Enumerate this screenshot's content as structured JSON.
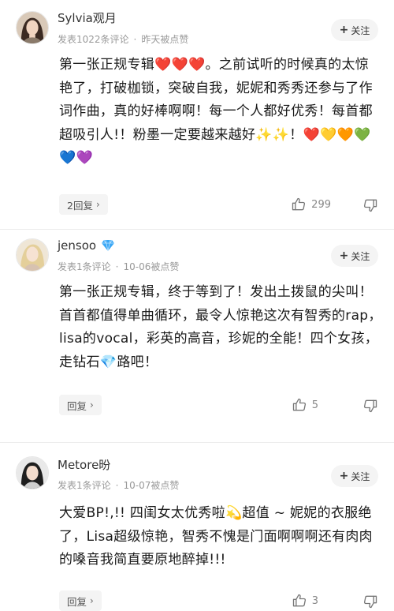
{
  "ui": {
    "follow_label": "关注",
    "follow_plus": "+",
    "reply_chevron": "›",
    "accent_color": "#e94b4b"
  },
  "comments": [
    {
      "username": "Sylvia观月",
      "badge": "",
      "meta_posts": "发表1022条评论",
      "meta_likes": "昨天被点赞",
      "content": "第一张正规专辑❤️❤️❤️。之前试听的时候真的太惊艳了，打破枷锁，突破自我，妮妮和秀秀还参与了作词作曲，真的好棒啊啊！每一个人都好优秀！每首都超吸引人!！粉墨一定要越来越好✨✨！❤️💛🧡💚💙💜",
      "reply_label": "2回复",
      "like_count": "299"
    },
    {
      "username": "jensoo",
      "badge": "diamond-icon",
      "meta_posts": "发表1条评论",
      "meta_likes": "10-06被点赞",
      "content": "第一张正规专辑，终于等到了！发出土拨鼠的尖叫！首首都值得单曲循环，最令人惊艳这次有智秀的rap，lisa的vocal，彩英的高音，珍妮的全能！四个女孩，走钻石💎路吧！",
      "reply_label": "回复",
      "like_count": "5"
    },
    {
      "username": "Metore昐",
      "badge": "",
      "meta_posts": "发表1条评论",
      "meta_likes": "10-07被点赞",
      "content": "大爱BP!,!! 四闺女太优秀啦💫超值 ~ 妮妮的衣服绝了，Lisa超级惊艳，智秀不愧是门面啊啊啊还有肉肉的嗓音我简直要原地醉掉!!!",
      "reply_label": "回复",
      "like_count": "3"
    }
  ]
}
